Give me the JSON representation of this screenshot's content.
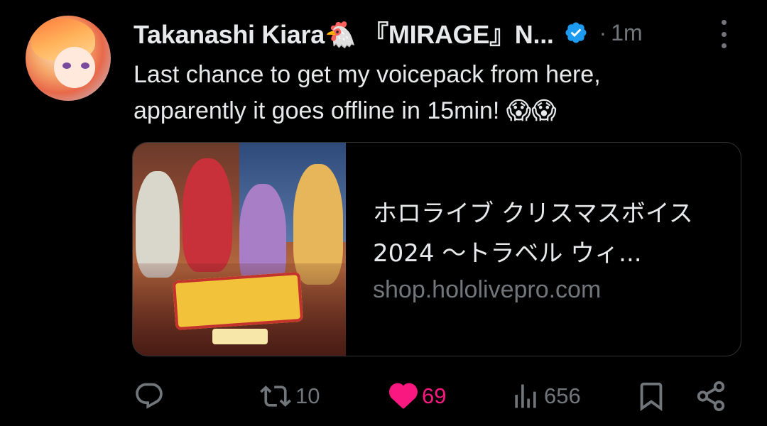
{
  "author": {
    "display_name": "Takanashi Kiara🐔 『MIRAGE』N...",
    "verified": true,
    "separator": "·",
    "time": "1m"
  },
  "tweet": {
    "text": "Last chance to get my voicepack from here,\napparently it goes offline in 15min! 😱😱"
  },
  "card": {
    "title": "ホロライブ クリスマスボイス2024 〜トラベル ウィ...",
    "domain": "shop.hololivepro.com"
  },
  "actions": {
    "replies": "",
    "retweets": "10",
    "likes": "69",
    "views": "656"
  },
  "colors": {
    "background": "#000000",
    "text": "#e7e9ea",
    "secondary": "#71767b",
    "like": "#f91880",
    "verified": "#1d9bf0",
    "border": "#2f3336"
  },
  "icons": [
    "reply-icon",
    "retweet-icon",
    "like-icon",
    "views-icon",
    "bookmark-icon",
    "share-icon",
    "more-icon",
    "verified-badge-icon"
  ]
}
